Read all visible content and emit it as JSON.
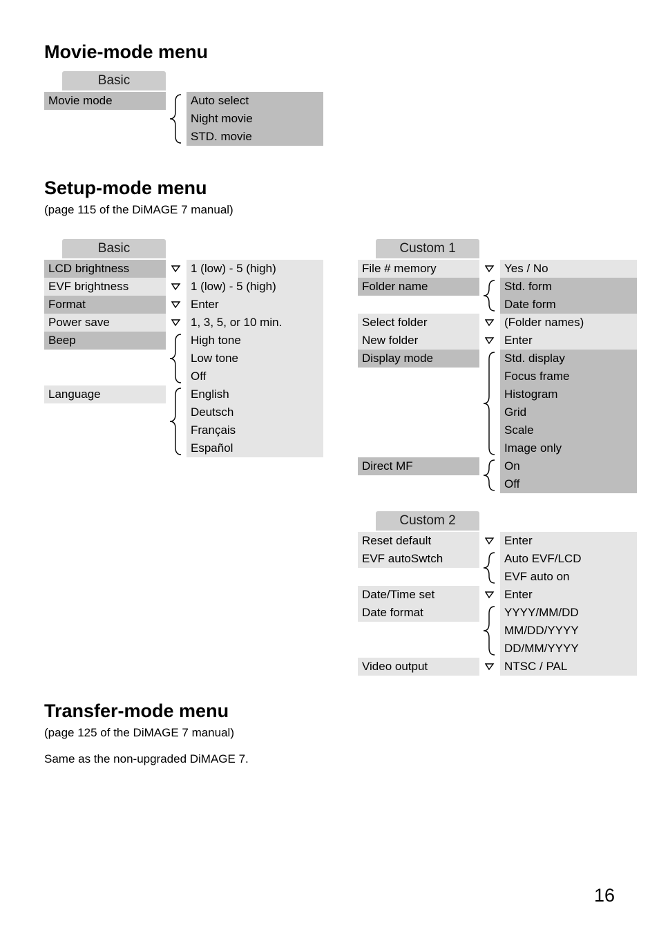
{
  "movie_mode_menu": {
    "title": "Movie-mode menu",
    "basic": {
      "header": "Basic",
      "rows": [
        {
          "item": "Movie mode",
          "dark": true,
          "values": [
            "Auto select",
            "Night movie",
            "STD. movie"
          ],
          "vals_dark": true
        }
      ]
    }
  },
  "setup_mode_menu": {
    "title": "Setup-mode menu",
    "note": "(page 115 of the DiMAGE 7 manual)",
    "basic": {
      "header": "Basic",
      "rows": [
        {
          "item": "LCD brightness",
          "dark": true,
          "values": [
            "1 (low) - 5 (high)"
          ]
        },
        {
          "item": "EVF brightness",
          "values": [
            "1 (low) - 5 (high)"
          ]
        },
        {
          "item": "Format",
          "dark": true,
          "values": [
            "Enter"
          ]
        },
        {
          "item": "Power save",
          "values": [
            "1, 3, 5, or 10 min."
          ]
        },
        {
          "item": "Beep",
          "dark": true,
          "values": [
            "High tone",
            "Low tone",
            "Off"
          ]
        },
        {
          "item": "Language",
          "values": [
            "English",
            "Deutsch",
            "Français",
            "Español"
          ]
        }
      ]
    },
    "custom1": {
      "header": "Custom 1",
      "rows": [
        {
          "item": "File # memory",
          "values": [
            "Yes / No"
          ]
        },
        {
          "item": "Folder name",
          "dark": true,
          "values": [
            "Std. form",
            "Date form"
          ],
          "vals_dark": true
        },
        {
          "item": "Select folder",
          "values": [
            "(Folder names)"
          ]
        },
        {
          "item": "New folder",
          "values": [
            "Enter"
          ]
        },
        {
          "item": "Display mode",
          "dark": true,
          "values": [
            "Std. display",
            "Focus frame",
            "Histogram",
            "Grid",
            "Scale",
            "Image only"
          ],
          "vals_dark": true
        },
        {
          "item": "Direct MF",
          "dark": true,
          "values": [
            "On",
            "Off"
          ],
          "vals_dark": true
        }
      ]
    },
    "custom2": {
      "header": "Custom 2",
      "rows": [
        {
          "item": "Reset default",
          "values": [
            "Enter"
          ]
        },
        {
          "item": "EVF autoSwtch",
          "values": [
            "Auto EVF/LCD",
            "EVF auto on"
          ]
        },
        {
          "item": "Date/Time set",
          "values": [
            "Enter"
          ]
        },
        {
          "item": "Date format",
          "values": [
            "YYYY/MM/DD",
            "MM/DD/YYYY",
            "DD/MM/YYYY"
          ]
        },
        {
          "item": "Video output",
          "values": [
            "NTSC / PAL"
          ]
        }
      ]
    }
  },
  "transfer_mode_menu": {
    "title": "Transfer-mode menu",
    "note": "(page 125 of the DiMAGE 7 manual)",
    "body": "Same as the non-upgraded DiMAGE 7."
  },
  "page_number": "16"
}
